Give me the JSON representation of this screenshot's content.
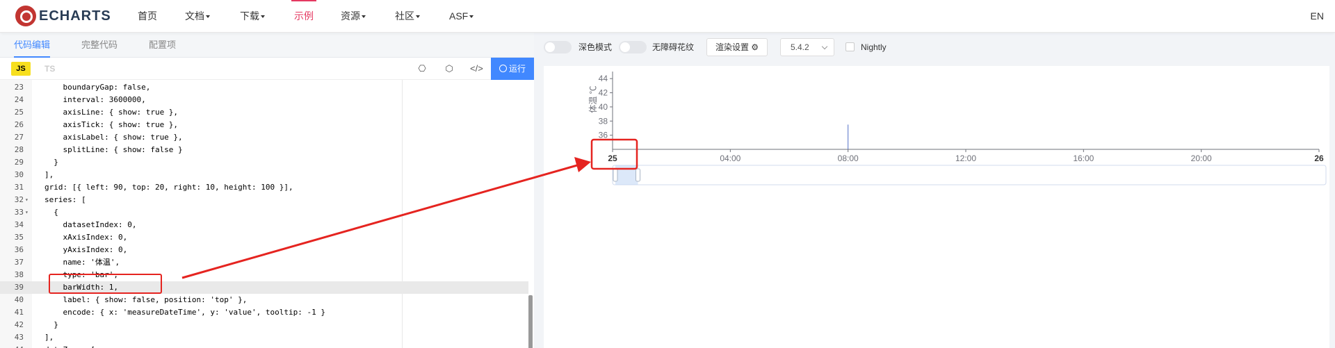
{
  "nav": {
    "logo_text": "ECHARTS",
    "items": [
      {
        "label": "首页",
        "has_caret": false
      },
      {
        "label": "文档",
        "has_caret": true
      },
      {
        "label": "下载",
        "has_caret": true
      },
      {
        "label": "示例",
        "has_caret": false,
        "active": true
      },
      {
        "label": "资源",
        "has_caret": true
      },
      {
        "label": "社区",
        "has_caret": true
      },
      {
        "label": "ASF",
        "has_caret": true
      }
    ],
    "lang": "EN"
  },
  "editor_tabs": [
    "代码编辑",
    "完整代码",
    "配置项"
  ],
  "toolbar": {
    "js": "JS",
    "ts": "TS",
    "run": "运行"
  },
  "code_lines": [
    {
      "n": "23",
      "fold": "",
      "text": "    boundaryGap: false,"
    },
    {
      "n": "24",
      "fold": "",
      "text": "    interval: 3600000,"
    },
    {
      "n": "25",
      "fold": "",
      "text": "    axisLine: { show: true },"
    },
    {
      "n": "26",
      "fold": "",
      "text": "    axisTick: { show: true },"
    },
    {
      "n": "27",
      "fold": "",
      "text": "    axisLabel: { show: true },"
    },
    {
      "n": "28",
      "fold": "",
      "text": "    splitLine: { show: false }"
    },
    {
      "n": "29",
      "fold": "",
      "text": "  }"
    },
    {
      "n": "30",
      "fold": "",
      "text": "],"
    },
    {
      "n": "31",
      "fold": "",
      "text": "grid: [{ left: 90, top: 20, right: 10, height: 100 }],"
    },
    {
      "n": "32",
      "fold": "▾",
      "text": "series: ["
    },
    {
      "n": "33",
      "fold": "▾",
      "text": "  {"
    },
    {
      "n": "34",
      "fold": "",
      "text": "    datasetIndex: 0,"
    },
    {
      "n": "35",
      "fold": "",
      "text": "    xAxisIndex: 0,"
    },
    {
      "n": "36",
      "fold": "",
      "text": "    yAxisIndex: 0,"
    },
    {
      "n": "37",
      "fold": "",
      "text": "    name: '体温',"
    },
    {
      "n": "38",
      "fold": "",
      "text": "    type: 'bar',"
    },
    {
      "n": "39",
      "fold": "",
      "text": "    barWidth: 1,",
      "current": true
    },
    {
      "n": "40",
      "fold": "",
      "text": "    label: { show: false, position: 'top' },"
    },
    {
      "n": "41",
      "fold": "",
      "text": "    encode: { x: 'measureDateTime', y: 'value', tooltip: -1 }"
    },
    {
      "n": "42",
      "fold": "",
      "text": "  }"
    },
    {
      "n": "43",
      "fold": "",
      "text": "],"
    },
    {
      "n": "44",
      "fold": "▾",
      "text": "dataZoom: ["
    }
  ],
  "right_toolbar": {
    "dark_mode": "深色模式",
    "aria_pattern": "无障碍花纹",
    "render_settings": "渲染设置",
    "version": "5.4.2",
    "nightly": "Nightly"
  },
  "colors": {
    "accent": "#4188ff",
    "nav_active": "#e43961",
    "annotation": "#e52420",
    "bar": "#5470c6"
  },
  "chart_data": {
    "type": "bar",
    "ylabel": "体温 ℃",
    "ylim": [
      34,
      45
    ],
    "y_ticks": [
      "36",
      "38",
      "40",
      "42",
      "44"
    ],
    "x_ticks": [
      "25",
      "04:00",
      "08:00",
      "12:00",
      "16:00",
      "20:00",
      "26"
    ],
    "x_range_hours": [
      0,
      24
    ],
    "bars": [
      {
        "x_hours": 8,
        "value": 37.5
      }
    ],
    "datazoom": {
      "start_fraction": 0,
      "end_fraction": 0.032
    }
  }
}
